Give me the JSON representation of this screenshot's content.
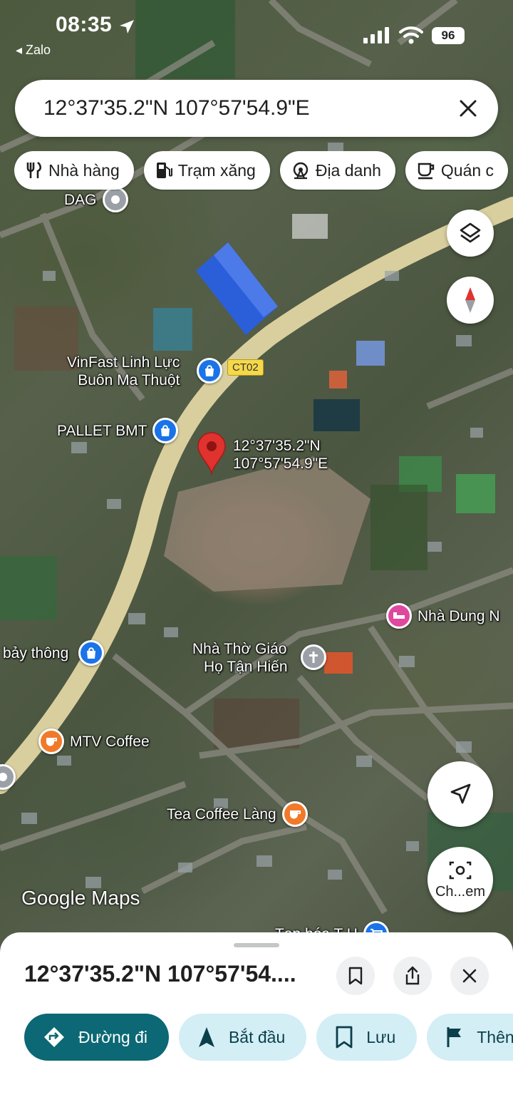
{
  "status_bar": {
    "time": "08:35",
    "back_app": "◂ Zalo",
    "battery": "96"
  },
  "search": {
    "query": "12°37'35.2\"N 107°57'54.9\"E"
  },
  "chips": [
    {
      "label": "Nhà hàng",
      "icon": "restaurant-icon"
    },
    {
      "label": "Trạm xăng",
      "icon": "gas-station-icon"
    },
    {
      "label": "Địa danh",
      "icon": "landmark-icon"
    },
    {
      "label": "Quán c",
      "icon": "cafe-icon"
    }
  ],
  "map": {
    "road_label": "CT02",
    "pin": {
      "line1": "12°37'35.2\"N",
      "line2": "107°57'54.9\"E"
    },
    "pois": {
      "dag": "DAG",
      "vinfast_1": "VinFast Linh Lực",
      "vinfast_2": "Buôn Ma Thuột",
      "pallet": "PALLET BMT",
      "nha_dung": "Nhà Dung N",
      "bay_thong": "bảy thông",
      "church_1": "Nhà Thờ Giáo",
      "church_2": "Họ Tận Hiến",
      "mtv": "MTV Coffee",
      "tea": "Tea Coffee Làng",
      "taphoa": "Tạp hóa T H"
    },
    "google_logo": "Google Maps",
    "camera_label": "Ch...em"
  },
  "sheet": {
    "title": "12°37'35.2\"N 107°57'54....",
    "actions": [
      {
        "label": "Đường đi",
        "icon": "directions-icon"
      },
      {
        "label": "Bắt đầu",
        "icon": "navigation-arrow-icon"
      },
      {
        "label": "Lưu",
        "icon": "bookmark-icon"
      },
      {
        "label": "Thên",
        "icon": "flag-icon"
      }
    ]
  },
  "colors": {
    "primary": "#0b6874",
    "action_bg": "#d3eef5",
    "pin_red": "#e0322e",
    "road": "#d9cf9e",
    "cafe_orange": "#f07a2a",
    "shop_blue": "#1a73e8",
    "hotel_pink": "#e0479e"
  }
}
